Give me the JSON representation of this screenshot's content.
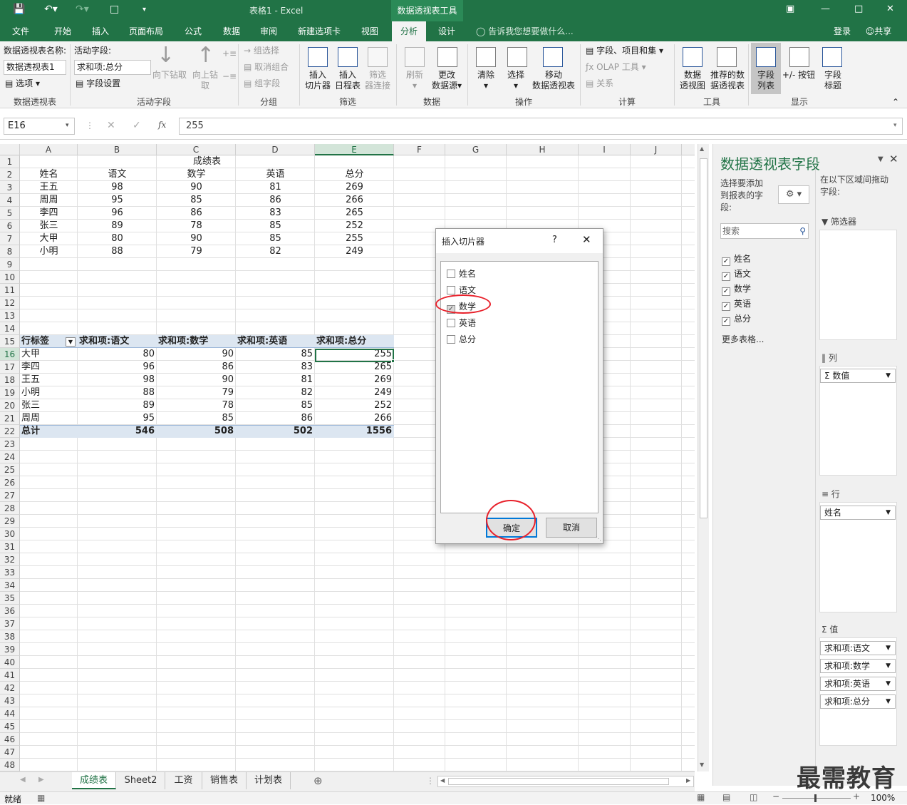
{
  "window": {
    "title": "表格1 - Excel",
    "context_tab": "数据透视表工具",
    "login": "登录",
    "share": "共享"
  },
  "tabs": [
    "文件",
    "开始",
    "插入",
    "页面布局",
    "公式",
    "数据",
    "审阅",
    "新建选项卡",
    "视图",
    "分析",
    "设计"
  ],
  "tell_me": "告诉我您想要做什么...",
  "ribbon": {
    "pivot_name_label": "数据透视表名称:",
    "pivot_name_value": "数据透视表1",
    "options": "选项",
    "group_pivot": "数据透视表",
    "active_field_label": "活动字段:",
    "active_field_value": "求和项:总分",
    "field_settings": "字段设置",
    "drill_down": "向下钻取",
    "drill_up_1": "向上钻",
    "drill_up_2": "取",
    "group_active_field": "活动字段",
    "group_selection": "组选择",
    "ungroup": "取消组合",
    "group_field": "组字段",
    "group_group": "分组",
    "insert_slicer_1": "插入",
    "insert_slicer_2": "切片器",
    "insert_timeline_1": "插入",
    "insert_timeline_2": "日程表",
    "filter_conn_1": "筛选",
    "filter_conn_2": "器连接",
    "group_filter": "筛选",
    "refresh": "刷新",
    "change_source_1": "更改",
    "change_source_2": "数据源",
    "group_data": "数据",
    "clear": "清除",
    "select": "选择",
    "move_1": "移动",
    "move_2": "数据透视表",
    "group_actions": "操作",
    "fields_items_sets": "字段、项目和集",
    "olap_tools": "OLAP 工具",
    "relationships": "关系",
    "group_calc": "计算",
    "pivot_chart_1": "数据",
    "pivot_chart_2": "透视图",
    "recommended_1": "推荐的数",
    "recommended_2": "据透视表",
    "group_tools": "工具",
    "field_list_1": "字段",
    "field_list_2": "列表",
    "plus_minus": "+/- 按钮",
    "field_headers_1": "字段",
    "field_headers_2": "标题",
    "group_show": "显示"
  },
  "formula_bar": {
    "name_box": "E16",
    "formula": "255",
    "fx": "fx"
  },
  "columns": [
    "A",
    "B",
    "C",
    "D",
    "E",
    "F",
    "G",
    "H",
    "I",
    "J"
  ],
  "rows": [
    "1",
    "2",
    "3",
    "4",
    "5",
    "6",
    "7",
    "8",
    "9",
    "10",
    "11",
    "12",
    "13",
    "14",
    "15",
    "16",
    "17",
    "18",
    "19",
    "20",
    "21",
    "22",
    "23",
    "24",
    "25",
    "26",
    "27",
    "28",
    "29",
    "30",
    "31",
    "32",
    "33",
    "34",
    "35",
    "36",
    "37",
    "38",
    "39",
    "40",
    "41",
    "42",
    "43",
    "44",
    "45",
    "46",
    "47",
    "48"
  ],
  "source_table": {
    "title": "成绩表",
    "headers": [
      "姓名",
      "语文",
      "数学",
      "英语",
      "总分"
    ],
    "rows": [
      [
        "王五",
        "98",
        "90",
        "81",
        "269"
      ],
      [
        "周周",
        "95",
        "85",
        "86",
        "266"
      ],
      [
        "李四",
        "96",
        "86",
        "83",
        "265"
      ],
      [
        "张三",
        "89",
        "78",
        "85",
        "252"
      ],
      [
        "大甲",
        "80",
        "90",
        "85",
        "255"
      ],
      [
        "小明",
        "88",
        "79",
        "82",
        "249"
      ]
    ]
  },
  "pivot": {
    "headers": [
      "行标签",
      "求和项:语文",
      "求和项:数学",
      "求和项:英语",
      "求和项:总分"
    ],
    "rows": [
      [
        "大甲",
        "80",
        "90",
        "85",
        "255"
      ],
      [
        "李四",
        "96",
        "86",
        "83",
        "265"
      ],
      [
        "王五",
        "98",
        "90",
        "81",
        "269"
      ],
      [
        "小明",
        "88",
        "79",
        "82",
        "249"
      ],
      [
        "张三",
        "89",
        "78",
        "85",
        "252"
      ],
      [
        "周周",
        "95",
        "85",
        "86",
        "266"
      ]
    ],
    "total": [
      "总计",
      "546",
      "508",
      "502",
      "1556"
    ]
  },
  "sheet_tabs": [
    "成绩表",
    "Sheet2",
    "工资",
    "销售表",
    "计划表"
  ],
  "status": {
    "ready": "就绪",
    "zoom": "100%"
  },
  "dialog": {
    "title": "插入切片器",
    "help": "?",
    "items": [
      {
        "label": "姓名",
        "checked": false
      },
      {
        "label": "语文",
        "checked": false
      },
      {
        "label": "数学",
        "checked": true
      },
      {
        "label": "英语",
        "checked": false
      },
      {
        "label": "总分",
        "checked": false
      }
    ],
    "ok": "确定",
    "cancel": "取消"
  },
  "field_panel": {
    "title": "数据透视表字段",
    "choose_label_1": "选择要添加",
    "choose_label_2": "到报表的字",
    "choose_label_3": "段:",
    "drag_label_1": "在以下区域间拖动",
    "drag_label_2": "字段:",
    "search_placeholder": "搜索",
    "fields": [
      "姓名",
      "语文",
      "数学",
      "英语",
      "总分"
    ],
    "more_tables": "更多表格...",
    "filters": "筛选器",
    "columns": "列",
    "columns_item": "数值",
    "rows": "行",
    "rows_item": "姓名",
    "values": "值",
    "values_items": [
      "求和项:语文",
      "求和项:数学",
      "求和项:英语",
      "求和项:总分"
    ]
  },
  "watermark": "最需教育",
  "colors": {
    "excel_green": "#217346",
    "pivot_header": "#dce6f1",
    "annotation_red": "#e8202a"
  }
}
